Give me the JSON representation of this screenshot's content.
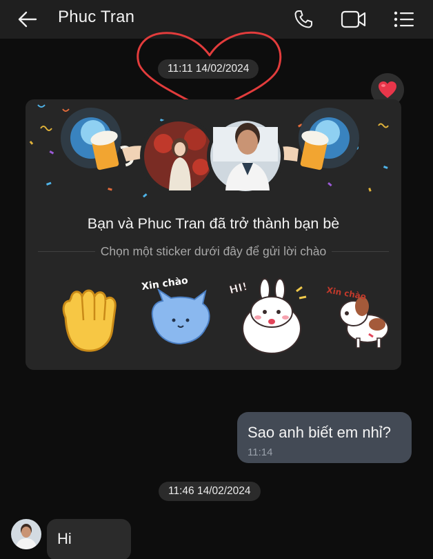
{
  "header": {
    "title": "Phuc Tran",
    "back_icon": "arrow-left-icon",
    "call_icon": "phone-icon",
    "video_icon": "video-camera-icon",
    "menu_icon": "list-menu-icon"
  },
  "timestamps": {
    "first": "11:11 14/02/2024",
    "second": "11:46 14/02/2024"
  },
  "friend_card": {
    "title": "Bạn và Phuc Tran đã trở thành bạn bè",
    "subtitle": "Chọn một sticker dưới đây để gửi lời chào",
    "sticker_text_2": "Xin chào",
    "sticker_text_3": "HI!",
    "sticker_text_4": "Xin chào"
  },
  "reaction": {
    "icon": "heart-icon"
  },
  "messages": {
    "outgoing": {
      "text": "Sao anh biết em nhỉ?",
      "time": "11:14"
    },
    "incoming": {
      "text": "Hi"
    }
  },
  "colors": {
    "background": "#0d0d0d",
    "header": "#1f1f1f",
    "card": "#262626",
    "outgoing_bubble": "#434a55",
    "incoming_bubble": "#2b2b2b",
    "heart_annotation": "#e23c3c"
  }
}
